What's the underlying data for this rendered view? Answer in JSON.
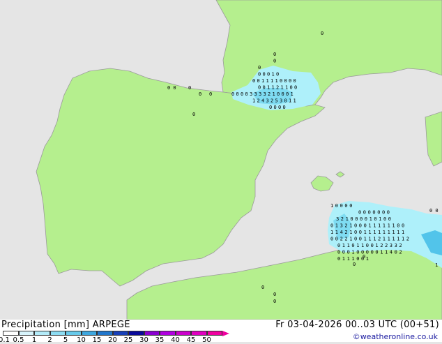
{
  "header": {
    "title_left": "Precipitation [mm]  ARPEGE",
    "title_right": "Fr 03-04-2026 00..03 UTC (00+51)",
    "credit": "©weatheronline.co.uk"
  },
  "legend": {
    "labels": [
      "0.1",
      "0.5",
      "1",
      "2",
      "5",
      "10",
      "15",
      "20",
      "25",
      "30",
      "35",
      "40",
      "45",
      "50"
    ],
    "colors": [
      "#ffffff",
      "#d8f4fc",
      "#b3ebf9",
      "#8ddcf2",
      "#67c9ea",
      "#3ea7df",
      "#2277cc",
      "#1840b8",
      "#0a0a9a",
      "#8a00d0",
      "#b000e0",
      "#cc00cc",
      "#e000c0",
      "#f000a0"
    ]
  },
  "map": {
    "land_color": "#b5ef8e",
    "sea_color": "#e5e5e5",
    "coast_color": "#9a9a9a",
    "rain_light": "#aef0fa",
    "rain_mid": "#7fdcf2",
    "rain_strong": "#52c4ea",
    "pyrenees_values": [
      [
        "0"
      ],
      [
        "0"
      ],
      [
        "0"
      ],
      [
        "0",
        "0",
        "0",
        "1",
        "0"
      ],
      [
        "0",
        "0",
        "1",
        "1",
        "1",
        "1",
        "0",
        "0",
        "0",
        "0"
      ],
      [
        "0",
        "0",
        "1",
        "1",
        "2",
        "1",
        "1",
        "0",
        "0"
      ],
      [
        "0",
        "0",
        "0",
        "0",
        "3",
        "3",
        "3",
        "3",
        "2",
        "1",
        "0",
        "0",
        "0",
        "1"
      ],
      [
        "1",
        "2",
        "4",
        "3",
        "2",
        "5",
        "3",
        "0",
        "1",
        "1"
      ],
      [
        "0",
        "0",
        "0",
        "0"
      ]
    ],
    "algeria_values": [
      [
        "1",
        "0",
        "0",
        "0",
        "0"
      ],
      [
        "0",
        "0",
        "0",
        "0",
        "0",
        "0",
        "0"
      ],
      [
        "3",
        "2",
        "1",
        "0",
        "0",
        "0",
        "0",
        "1",
        "0",
        "1",
        "0",
        "0"
      ],
      [
        "0",
        "1",
        "3",
        "2",
        "1",
        "0",
        "0",
        "0",
        "1",
        "1",
        "1",
        "1",
        "1",
        "1",
        "0",
        "0"
      ],
      [
        "1",
        "1",
        "4",
        "2",
        "1",
        "0",
        "0",
        "1",
        "1",
        "1",
        "1",
        "1",
        "1",
        "1",
        "1",
        "1"
      ],
      [
        "0",
        "0",
        "2",
        "2",
        "1",
        "0",
        "0",
        "1",
        "1",
        "1",
        "2",
        "1",
        "1",
        "1",
        "1",
        "1",
        "2"
      ],
      [
        "0",
        "1",
        "1",
        "0",
        "1",
        "1",
        "0",
        "0",
        "1",
        "2",
        "2",
        "3",
        "3",
        "2"
      ],
      [
        "0",
        "0",
        "0",
        "1",
        "0",
        "0",
        "0",
        "0",
        "0",
        "1",
        "1",
        "4",
        "0",
        "2"
      ],
      [
        "0",
        "1",
        "1",
        "1",
        "0",
        "0",
        "1"
      ]
    ]
  }
}
